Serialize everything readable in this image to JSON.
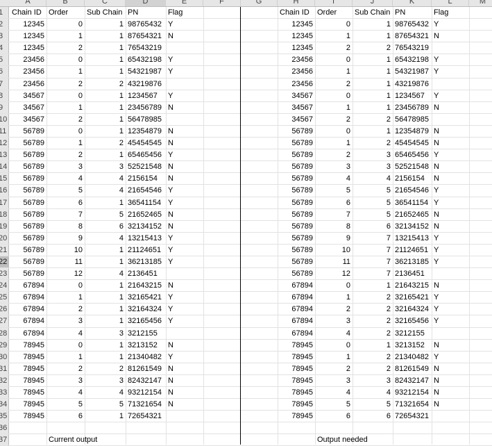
{
  "col_headers": [
    "A",
    "B",
    "C",
    "D",
    "E",
    "F",
    "G",
    "H",
    "I",
    "J",
    "K",
    "L",
    "M"
  ],
  "selected_column": "D",
  "selected_row": "22",
  "row_numbers": [
    "1",
    "2",
    "3",
    "4",
    "5",
    "6",
    "7",
    "8",
    "9",
    "10",
    "11",
    "12",
    "13",
    "14",
    "15",
    "16",
    "17",
    "18",
    "19",
    "20",
    "21",
    "22",
    "23",
    "24",
    "25",
    "26",
    "27",
    "28",
    "29",
    "30",
    "31",
    "32",
    "33",
    "34",
    "35",
    "36",
    "37"
  ],
  "left_header": [
    "Chain ID",
    "Order",
    "Sub Chain",
    "PN",
    "Flag"
  ],
  "right_header": [
    "Chain ID",
    "Order",
    "Sub Chain",
    "PN",
    "Flag"
  ],
  "current_output": [
    [
      "12345",
      "0",
      "1",
      "98765432",
      "Y"
    ],
    [
      "12345",
      "1",
      "1",
      "87654321",
      "N"
    ],
    [
      "12345",
      "2",
      "1",
      "76543219",
      ""
    ],
    [
      "23456",
      "0",
      "1",
      "65432198",
      "Y"
    ],
    [
      "23456",
      "1",
      "1",
      "54321987",
      "Y"
    ],
    [
      "23456",
      "2",
      "2",
      "43219876",
      ""
    ],
    [
      "34567",
      "0",
      "1",
      "1234567",
      "Y"
    ],
    [
      "34567",
      "1",
      "1",
      "23456789",
      "N"
    ],
    [
      "34567",
      "2",
      "1",
      "56478985",
      ""
    ],
    [
      "56789",
      "0",
      "1",
      "12354879",
      "N"
    ],
    [
      "56789",
      "1",
      "2",
      "45454545",
      "N"
    ],
    [
      "56789",
      "2",
      "1",
      "65465456",
      "Y"
    ],
    [
      "56789",
      "3",
      "3",
      "52521548",
      "N"
    ],
    [
      "56789",
      "4",
      "4",
      "2156154",
      "N"
    ],
    [
      "56789",
      "5",
      "4",
      "21654546",
      "Y"
    ],
    [
      "56789",
      "6",
      "1",
      "36541154",
      "Y"
    ],
    [
      "56789",
      "7",
      "5",
      "21652465",
      "N"
    ],
    [
      "56789",
      "8",
      "6",
      "32134152",
      "N"
    ],
    [
      "56789",
      "9",
      "4",
      "13215413",
      "Y"
    ],
    [
      "56789",
      "10",
      "1",
      "21124651",
      "Y"
    ],
    [
      "56789",
      "11",
      "1",
      "36213185",
      "Y"
    ],
    [
      "56789",
      "12",
      "4",
      "2136451",
      ""
    ],
    [
      "67894",
      "0",
      "1",
      "21643215",
      "N"
    ],
    [
      "67894",
      "1",
      "1",
      "32165421",
      "Y"
    ],
    [
      "67894",
      "2",
      "1",
      "32164324",
      "Y"
    ],
    [
      "67894",
      "3",
      "1",
      "32165456",
      "Y"
    ],
    [
      "67894",
      "4",
      "3",
      "3212155",
      ""
    ],
    [
      "78945",
      "0",
      "1",
      "3213152",
      "N"
    ],
    [
      "78945",
      "1",
      "1",
      "21340482",
      "Y"
    ],
    [
      "78945",
      "2",
      "2",
      "81261549",
      "N"
    ],
    [
      "78945",
      "3",
      "3",
      "82432147",
      "N"
    ],
    [
      "78945",
      "4",
      "4",
      "93212154",
      "N"
    ],
    [
      "78945",
      "5",
      "5",
      "71321654",
      "N"
    ],
    [
      "78945",
      "6",
      "1",
      "72654321",
      ""
    ]
  ],
  "output_needed": [
    [
      "12345",
      "0",
      "1",
      "98765432",
      "Y"
    ],
    [
      "12345",
      "1",
      "1",
      "87654321",
      "N"
    ],
    [
      "12345",
      "2",
      "2",
      "76543219",
      ""
    ],
    [
      "23456",
      "0",
      "1",
      "65432198",
      "Y"
    ],
    [
      "23456",
      "1",
      "1",
      "54321987",
      "Y"
    ],
    [
      "23456",
      "2",
      "1",
      "43219876",
      ""
    ],
    [
      "34567",
      "0",
      "1",
      "1234567",
      "Y"
    ],
    [
      "34567",
      "1",
      "1",
      "23456789",
      "N"
    ],
    [
      "34567",
      "2",
      "2",
      "56478985",
      ""
    ],
    [
      "56789",
      "0",
      "1",
      "12354879",
      "N"
    ],
    [
      "56789",
      "1",
      "2",
      "45454545",
      "N"
    ],
    [
      "56789",
      "2",
      "3",
      "65465456",
      "Y"
    ],
    [
      "56789",
      "3",
      "3",
      "52521548",
      "N"
    ],
    [
      "56789",
      "4",
      "4",
      "2156154",
      "N"
    ],
    [
      "56789",
      "5",
      "5",
      "21654546",
      "Y"
    ],
    [
      "56789",
      "6",
      "5",
      "36541154",
      "Y"
    ],
    [
      "56789",
      "7",
      "5",
      "21652465",
      "N"
    ],
    [
      "56789",
      "8",
      "6",
      "32134152",
      "N"
    ],
    [
      "56789",
      "9",
      "7",
      "13215413",
      "Y"
    ],
    [
      "56789",
      "10",
      "7",
      "21124651",
      "Y"
    ],
    [
      "56789",
      "11",
      "7",
      "36213185",
      "Y"
    ],
    [
      "56789",
      "12",
      "7",
      "2136451",
      ""
    ],
    [
      "67894",
      "0",
      "1",
      "21643215",
      "N"
    ],
    [
      "67894",
      "1",
      "2",
      "32165421",
      "Y"
    ],
    [
      "67894",
      "2",
      "2",
      "32164324",
      "Y"
    ],
    [
      "67894",
      "3",
      "2",
      "32165456",
      "Y"
    ],
    [
      "67894",
      "4",
      "2",
      "3212155",
      ""
    ],
    [
      "78945",
      "0",
      "1",
      "3213152",
      "N"
    ],
    [
      "78945",
      "1",
      "2",
      "21340482",
      "Y"
    ],
    [
      "78945",
      "2",
      "2",
      "81261549",
      "N"
    ],
    [
      "78945",
      "3",
      "3",
      "82432147",
      "N"
    ],
    [
      "78945",
      "4",
      "4",
      "93212154",
      "N"
    ],
    [
      "78945",
      "5",
      "5",
      "71321654",
      "N"
    ],
    [
      "78945",
      "6",
      "6",
      "72654321",
      ""
    ]
  ],
  "captions": {
    "left": "Current output",
    "right": "Output needed"
  }
}
